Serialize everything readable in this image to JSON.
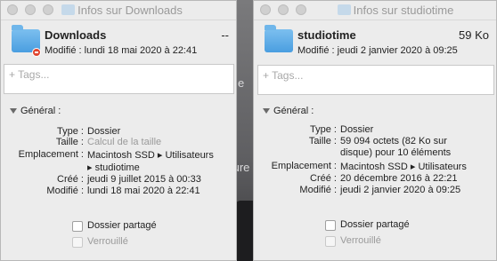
{
  "desktop": {
    "frag1": "e",
    "frag2": "ture"
  },
  "left": {
    "title": "Infos sur Downloads",
    "name": "Downloads",
    "size": "--",
    "modified_line": "Modifié :  lundi 18 mai 2020 à 22:41",
    "tags_placeholder": "+ Tags...",
    "section": "Général :",
    "rows": [
      {
        "label": "Type :",
        "value": "Dossier"
      },
      {
        "label": "Taille :",
        "value": "Calcul de la taille"
      },
      {
        "label": "Emplacement :",
        "value": "Macintosh SSD ▸ Utilisateurs"
      },
      {
        "label": "",
        "value": "▸ studiotime"
      },
      {
        "label": "Créé :",
        "value": "jeudi 9 juillet 2015 à 00:33"
      },
      {
        "label": "Modifié :",
        "value": "lundi 18 mai 2020 à 22:41"
      }
    ],
    "shared": "Dossier partagé",
    "locked": "Verrouillé"
  },
  "right": {
    "title": "Infos sur studiotime",
    "name": "studiotime",
    "size": "59 Ko",
    "modified_line": "Modifié :  jeudi 2 janvier 2020 à 09:25",
    "tags_placeholder": "+ Tags...",
    "section": "Général :",
    "rows": [
      {
        "label": "Type :",
        "value": "Dossier"
      },
      {
        "label": "Taille :",
        "value": "59 094 octets (82 Ko sur"
      },
      {
        "label": "",
        "value": "disque) pour 10 éléments"
      },
      {
        "label": "Emplacement :",
        "value": "Macintosh SSD ▸ Utilisateurs"
      },
      {
        "label": "Créé :",
        "value": "20 décembre 2016 à 22:21"
      },
      {
        "label": "Modifié :",
        "value": "jeudi 2 janvier 2020 à 09:25"
      }
    ],
    "shared": "Dossier partagé",
    "locked": "Verrouillé"
  }
}
